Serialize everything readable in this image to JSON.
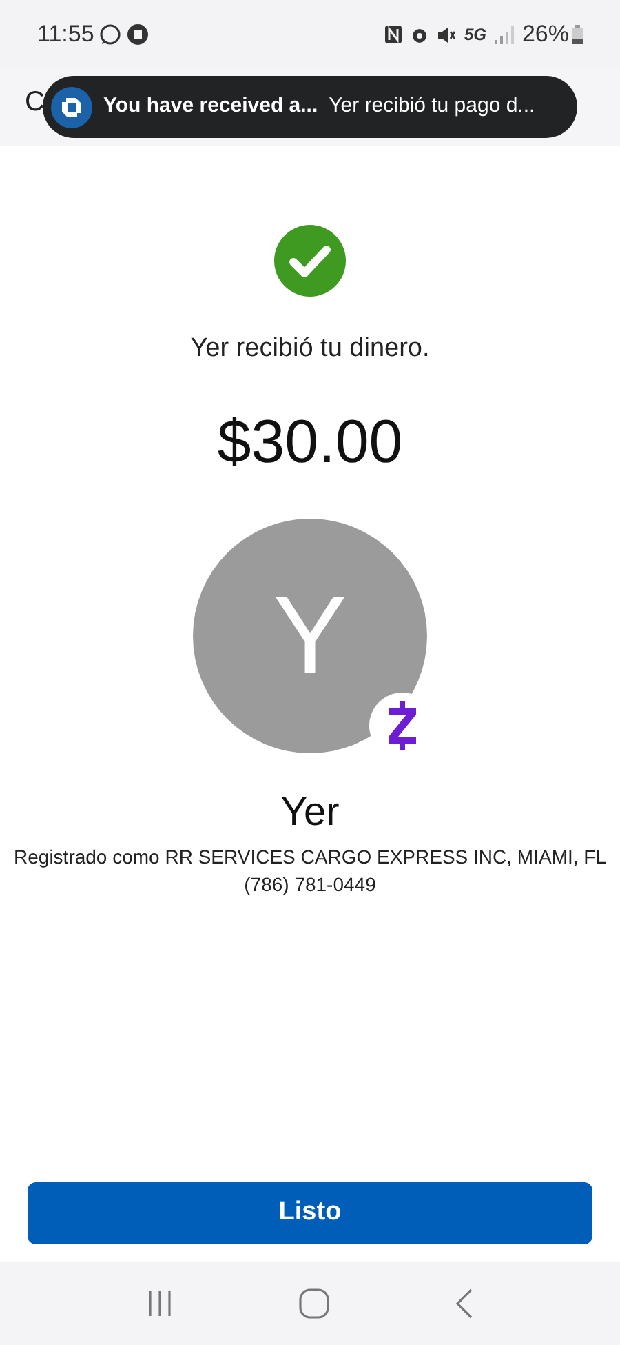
{
  "status_bar": {
    "time": "11:55",
    "network": "5G",
    "battery": "26%"
  },
  "header": {
    "title": "C"
  },
  "notification": {
    "title": "You have received a...",
    "body": "Yer recibió tu pago d..."
  },
  "message": "Yer recibió tu dinero.",
  "amount": "$30.00",
  "avatar": {
    "initial": "Y"
  },
  "recipient": {
    "name": "Yer",
    "registered": "Registrado como RR SERVICES CARGO EXPRESS INC, MIAMI, FL",
    "phone": "(786) 781-0449"
  },
  "done_button": "Listo"
}
